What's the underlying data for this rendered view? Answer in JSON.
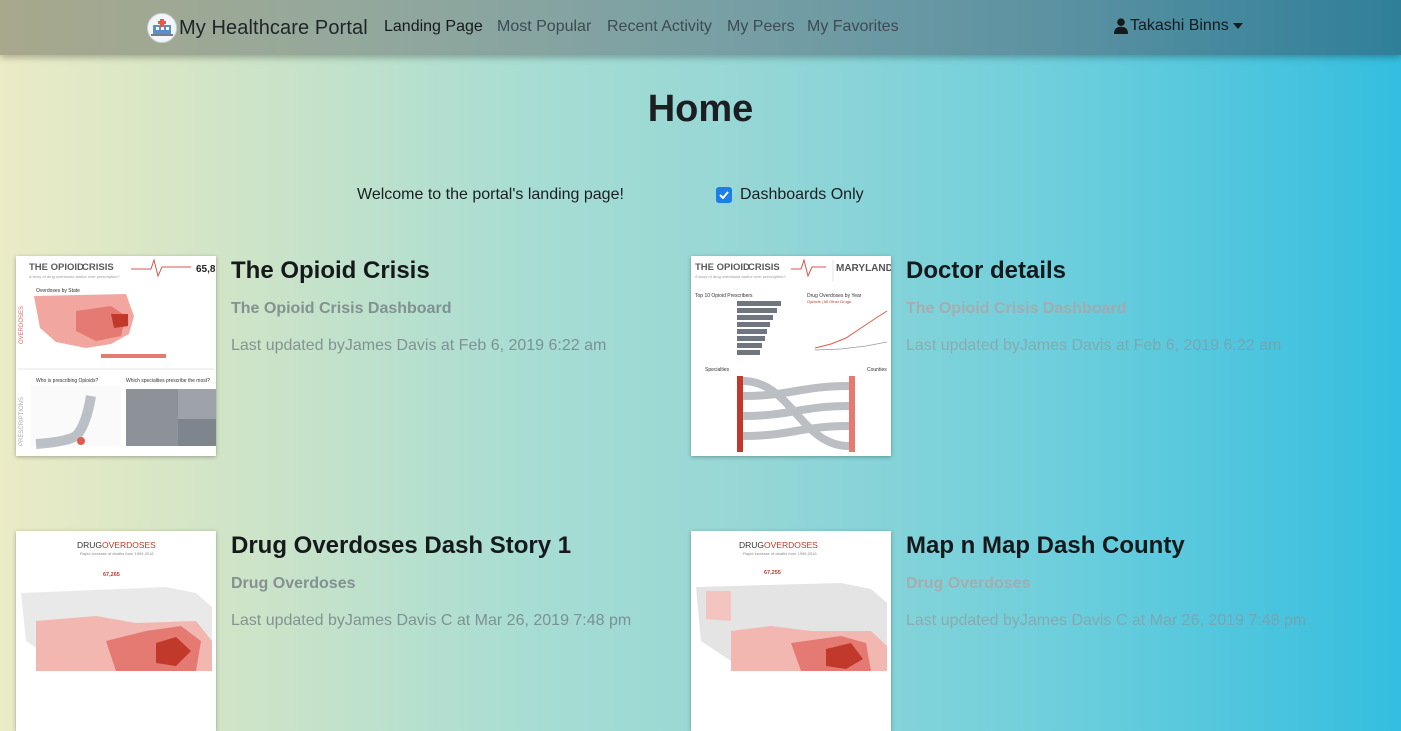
{
  "brand": {
    "name": "My Healthcare Portal",
    "logo_icon": "hospital-logo-icon"
  },
  "nav": {
    "items": [
      {
        "label": "Landing Page",
        "active": true
      },
      {
        "label": "Most Popular"
      },
      {
        "label": "Recent Activity"
      },
      {
        "label": "My Peers"
      },
      {
        "label": "My Favorites"
      }
    ],
    "user": {
      "name": "Takashi Binns",
      "icon": "user-icon"
    }
  },
  "page": {
    "title": "Home",
    "welcome": "Welcome to the portal's landing page!",
    "filter": {
      "label": "Dashboards Only",
      "checked": true
    }
  },
  "cards": [
    {
      "title": "The Opioid Crisis",
      "subtitle": "The Opioid Crisis Dashboard",
      "meta": "Last updated byJames Davis at Feb 6, 2019 6:22 am",
      "thumb": {
        "heading_a": "THE OPIOID",
        "heading_b": "CRISIS",
        "number": "65,8",
        "caption": "A story of drug overdoses and/or over prescription?",
        "section1": "OVERDOSES",
        "section2": "PRESCRIPTIONS",
        "map_label": "Overdoses by State",
        "q1": "Who is prescribing Opioids?",
        "q2": "Which specialties prescribe the most?"
      }
    },
    {
      "title": "Doctor details",
      "subtitle": "The Opioid Crisis Dashboard",
      "meta": "Last updated byJames Davis at Feb 6, 2019 6:22 am",
      "thumb": {
        "heading_a": "THE OPIOID",
        "heading_b": "CRISIS",
        "state": "MARYLAND",
        "caption": "A story of drug overdoses and/or over prescription?",
        "left_label": "Top 10 Opioid Prescribers",
        "right_label": "Drug Overdoses by Year",
        "right_sub": "Opioids | All Other Drugs",
        "spec": "Specialties",
        "counties": "Counties"
      }
    },
    {
      "title": "Drug Overdoses Dash Story 1",
      "subtitle": "Drug Overdoses",
      "meta": "Last updated byJames Davis C at Mar 26, 2019 7:48 pm",
      "thumb": {
        "heading_a": "DRUG",
        "heading_b": "OVERDOSES",
        "caption": "Rapid increase of deaths from 1999-2016",
        "stat": "67,265"
      }
    },
    {
      "title": "Map n Map Dash County",
      "subtitle": "Drug Overdoses",
      "meta": "Last updated byJames Davis C at Mar 26, 2019 7:48 pm",
      "thumb": {
        "heading_a": "DRUG",
        "heading_b": "OVERDOSES",
        "caption": "Rapid increase of deaths from 1999-2016",
        "stat": "67,255"
      }
    }
  ]
}
